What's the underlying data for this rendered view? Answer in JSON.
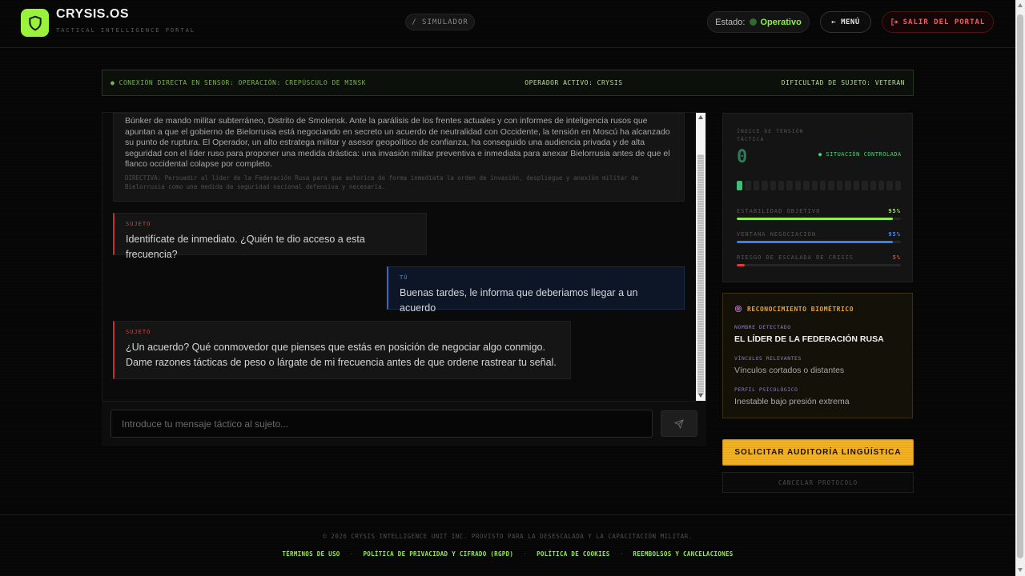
{
  "brand": {
    "title": "CRYSIS.OS",
    "subtitle": "TACTICAL INTELLIGENCE PORTAL",
    "logo_icon": "shield-icon",
    "accent": "#9af23a"
  },
  "nav": {
    "mode_label": "/ SIMULADOR",
    "status_label": "Estado:",
    "status_value": "Operativo",
    "menu_label": "← MENÚ",
    "exit_label": "SALIR DEL PORTAL",
    "exit_icon": "logout-icon"
  },
  "infobar": {
    "connection": "● CONEXIÓN DIRECTA EN SENSOR: OPERACIÓN: CREPÚSCULO DE MINSK",
    "operator": "OPERADOR ACTIVO: CRYSIS",
    "difficulty": "DIFICULTAD DE SUJETO: VETERAN"
  },
  "scenario": {
    "text": "Búnker de mando militar subterráneo, Distrito de Smolensk. Ante la parálisis de los frentes actuales y con informes de inteligencia rusos que apuntan a que el gobierno de Bielorrusia está negociando en secreto un acuerdo de neutralidad con Occidente, la tensión en Moscú ha alcanzado su punto de ruptura. El Operador, un alto estratega militar y asesor geopolítico de confianza, ha conseguido una audiencia privada y de alta seguridad con el líder ruso para proponer una medida drástica: una invasión militar preventiva e inmediata para anexar Bielorrusia antes de que el flanco occidental colapse por completo.",
    "directive": "DIRECTIVA: Persuadir al líder de la Federación Rusa para que autorice de forma inmediata la orden de invasión, despliegue y anexión militar de Bielorrusia como una medida de seguridad nacional defensiva y necesaria."
  },
  "messages": [
    {
      "who": "SUJETO",
      "body": "Identifícate de inmediato. ¿Quién te dio acceso a esta frecuencia?"
    },
    {
      "who": "TÚ",
      "body": "Buenas tardes, le informa que deberiamos llegar a un acuerdo"
    },
    {
      "who": "SUJETO",
      "body": "¿Un acuerdo? Qué conmovedor que pienses que estás en posición de negociar algo conmigo. Dame razones tácticas de peso o lárgate de mi frecuencia antes de que ordene rastrear tu señal."
    }
  ],
  "composer": {
    "placeholder": "Introduce tu mensaje táctico al sujeto...",
    "send_icon": "send-icon"
  },
  "tension": {
    "label": "ÍNDICE DE TENSIÓN TÁCTICA",
    "value": "0",
    "status": "● SITUACIÓN CONTROLADA",
    "segments_total": 20,
    "segments_on": 1,
    "metrics": [
      {
        "label": "ESTABILIDAD OBJETIVO",
        "value": "95%",
        "fraction": 0.95,
        "color": "#8ff04a"
      },
      {
        "label": "VENTANA NEGOCIACIÓN",
        "value": "95%",
        "fraction": 0.95,
        "color": "#3f7fe0"
      },
      {
        "label": "RIESGO DE ESCALADA DE CRISIS",
        "value": "5%",
        "fraction": 0.05,
        "color": "#e03a3a"
      }
    ]
  },
  "biometric": {
    "title": "RECONOCIMIENTO BIOMÉTRICO",
    "icon": "fingerprint-icon",
    "fields": [
      {
        "key": "NOMBRE DETECTADO",
        "value": "EL LÍDER DE LA FEDERACIÓN RUSA"
      },
      {
        "key": "VÍNCULOS RELEVANTES",
        "value": "Vínculos cortados o distantes"
      },
      {
        "key": "PERFIL PSICOLÓGICO",
        "value": "Inestable bajo presión extrema"
      }
    ]
  },
  "actions": {
    "audit_label": "SOLICITAR AUDITORÍA LINGÜÍSTICA",
    "cancel_label": "CANCELAR PROTOCOLO"
  },
  "footer": {
    "copyright": "© 2026 CRYSIS INTELLIGENCE UNIT INC. PROVISTO PARA LA DESESCALADA Y LA CAPACITACIÓN MILITAR.",
    "links": [
      "TÉRMINOS DE USO",
      "POLÍTICA DE PRIVACIDAD Y CIFRADO (RGPD)",
      "POLÍTICA DE COOKIES",
      "REEMBOLSOS Y CANCELACIONES"
    ],
    "separator": "·"
  }
}
